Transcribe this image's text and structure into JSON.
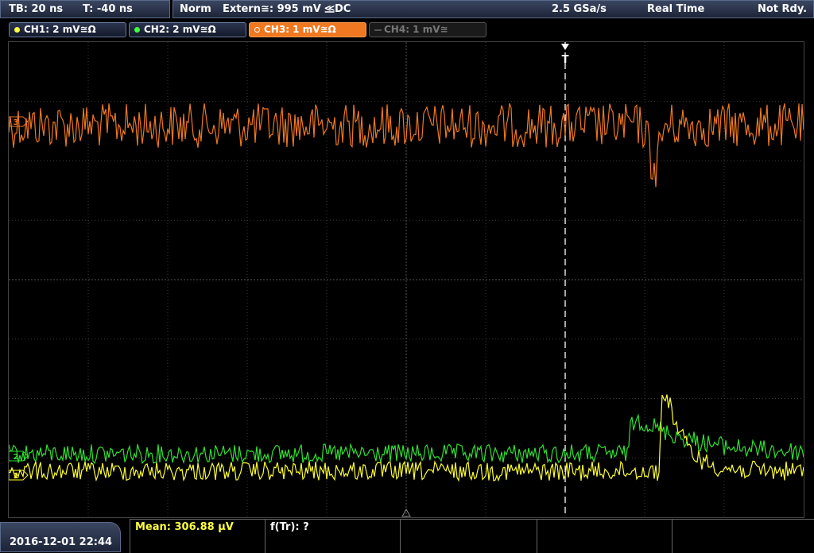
{
  "topbar": {
    "timebase": "TB: 20 ns",
    "trigger_time": "T: -40 ns",
    "mode": "Norm",
    "trigger_source": "Extern≅: 995 mV ⪣DC",
    "sample_rate": "2.5 GSa/s",
    "acq_mode": "Real Time",
    "status": "Not Rdy."
  },
  "channels": [
    {
      "label": "CH1: 2 mV≅Ω",
      "color": "#ffff40",
      "state": "on"
    },
    {
      "label": "CH2: 2 mV≅Ω",
      "color": "#40ff40",
      "state": "on"
    },
    {
      "label": "CH3: 1 mV≅Ω",
      "color": "#f07820",
      "state": "active"
    },
    {
      "label": "CH4: 1 mV≅",
      "color": "#777777",
      "state": "off"
    }
  ],
  "markers": {
    "trigger_label": "T",
    "ch3_marker": "3",
    "ch2_marker": "2",
    "ch1_marker": "1"
  },
  "colors": {
    "ch1": "#ffff30",
    "ch2": "#30e030",
    "ch3": "#f07820",
    "grid": "#3a3a3a"
  },
  "bottom": {
    "datetime": "2016-12-01 22:44",
    "mean": "Mean: 306.88 µV",
    "freq": "f(Tr): ?"
  }
}
